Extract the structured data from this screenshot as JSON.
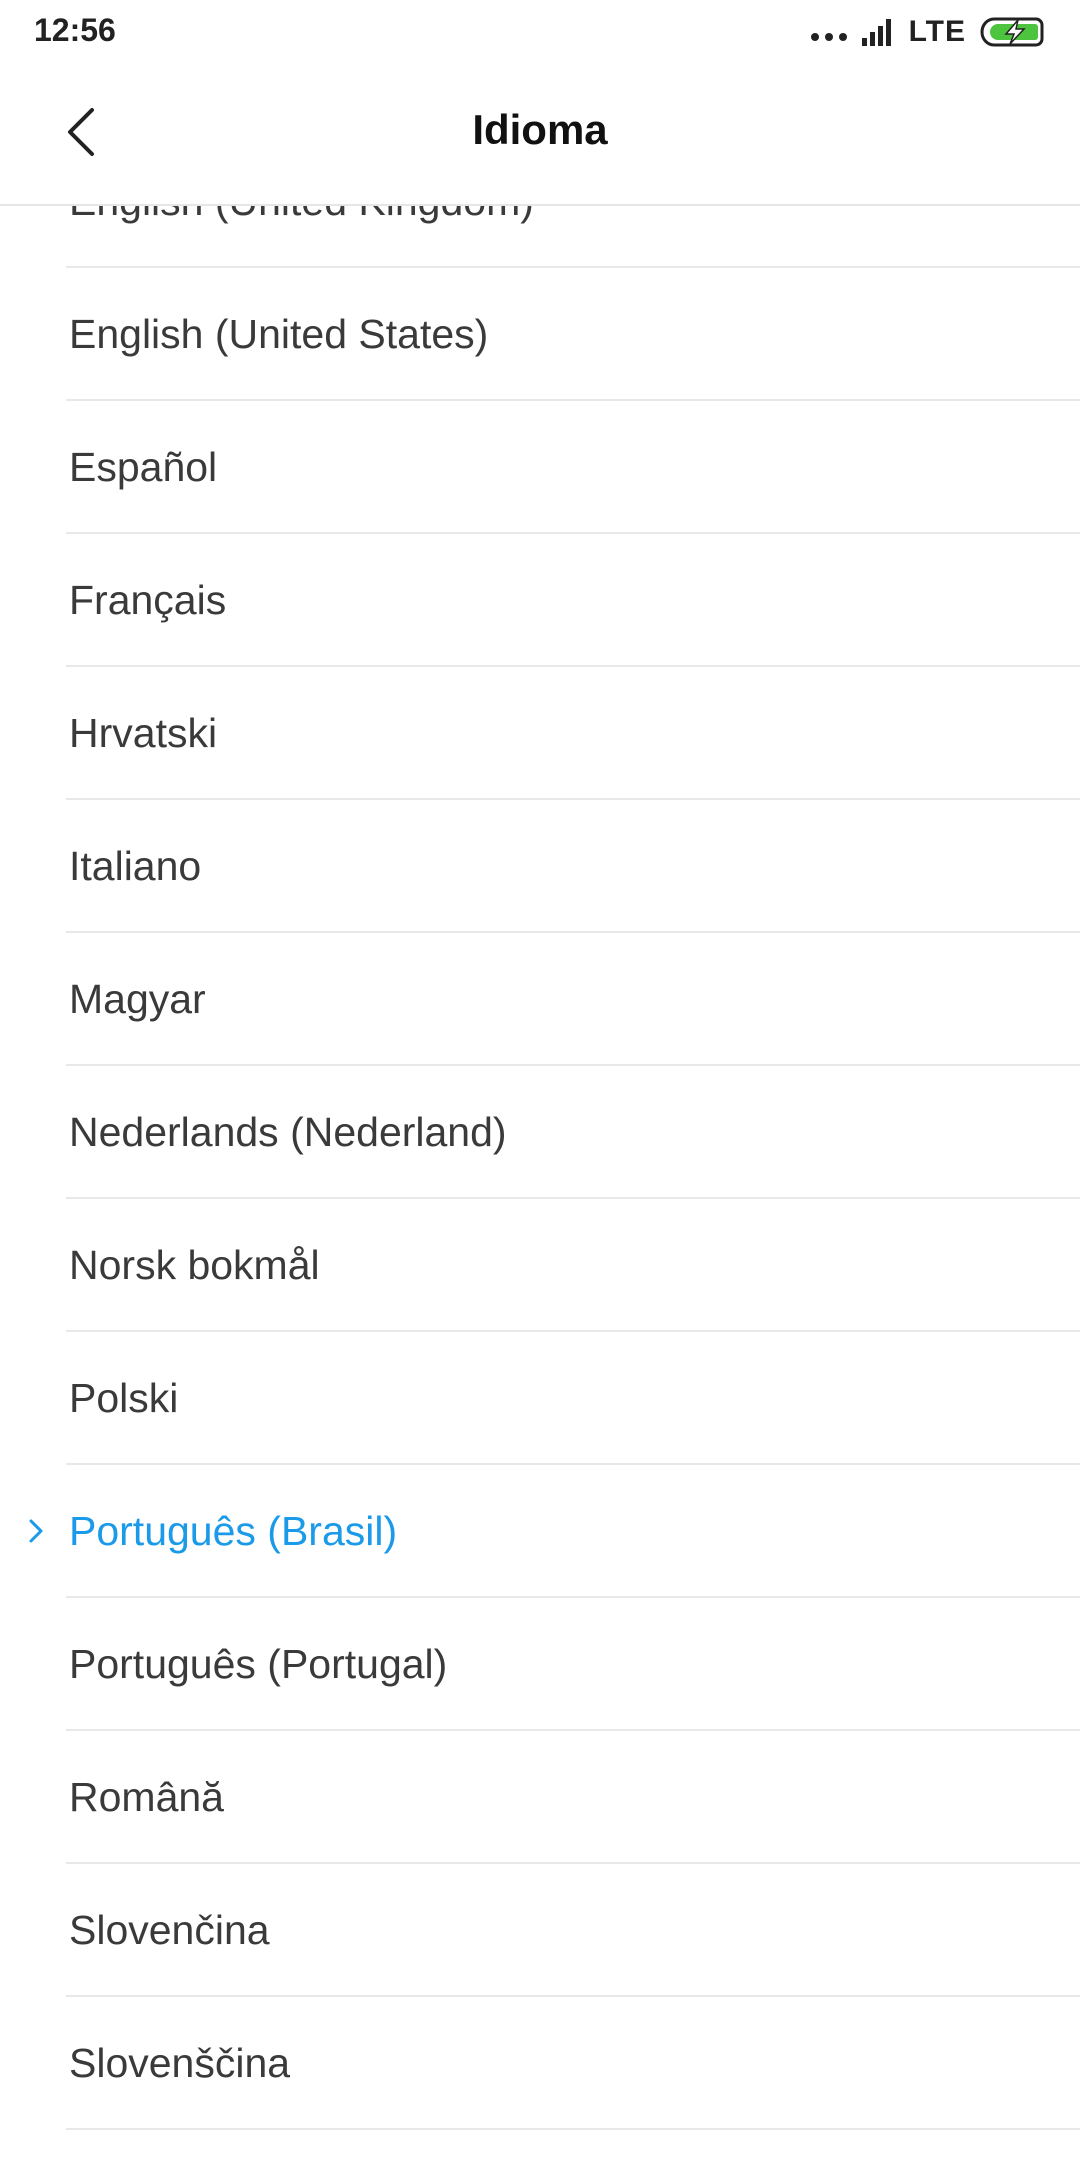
{
  "status_bar": {
    "time": "12:56",
    "network": "LTE",
    "icons": [
      "more-dots-icon",
      "signal-icon",
      "battery-charging-icon"
    ]
  },
  "header": {
    "title": "Idioma",
    "back_icon": "chevron-left-icon"
  },
  "languages": {
    "selected_index": 10,
    "selected_color": "#1a9ae8",
    "items": [
      "English (United Kingdom)",
      "English (United States)",
      "Español",
      "Français",
      "Hrvatski",
      "Italiano",
      "Magyar",
      "Nederlands (Nederland)",
      "Norsk bokmål",
      "Polski",
      "Português (Brasil)",
      "Português (Portugal)",
      "Română",
      "Slovenčina",
      "Slovenščina"
    ]
  }
}
